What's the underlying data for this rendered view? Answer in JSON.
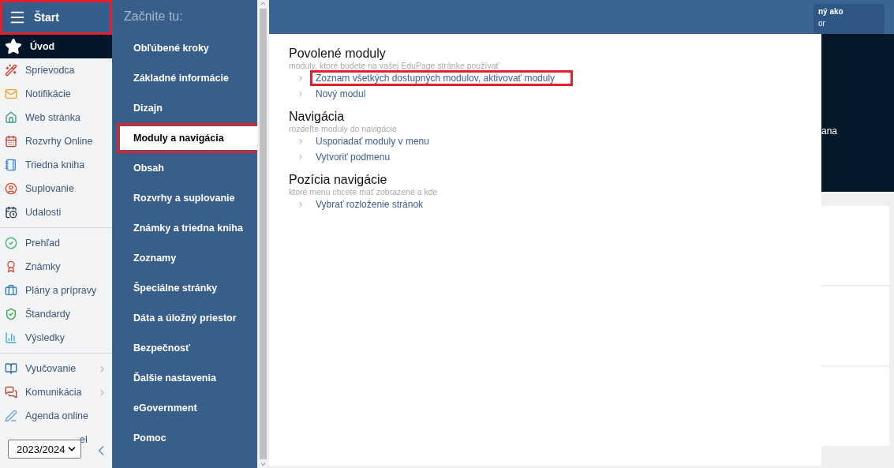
{
  "sidebar": {
    "header": {
      "label": "Štart",
      "highlighted": true
    },
    "groups": [
      {
        "items": [
          {
            "label": "Úvod",
            "selected": true,
            "has_submenu": false
          },
          {
            "label": "Sprievodca",
            "selected": false,
            "has_submenu": false
          },
          {
            "label": "Notifikácie",
            "selected": false,
            "has_submenu": false
          },
          {
            "label": "Web stránka",
            "selected": false,
            "has_submenu": false
          },
          {
            "label": "Rozvrhy Online",
            "selected": false,
            "has_submenu": false
          },
          {
            "label": "Triedna kniha",
            "selected": false,
            "has_submenu": false
          },
          {
            "label": "Suplovanie",
            "selected": false,
            "has_submenu": false
          },
          {
            "label": "Udalosti",
            "selected": false,
            "has_submenu": false
          }
        ]
      },
      {
        "items": [
          {
            "label": "Prehľad",
            "selected": false,
            "has_submenu": false
          },
          {
            "label": "Známky",
            "selected": false,
            "has_submenu": false
          },
          {
            "label": "Plány a prípravy",
            "selected": false,
            "has_submenu": false
          },
          {
            "label": "Štandardy",
            "selected": false,
            "has_submenu": false
          },
          {
            "label": "Výsledky",
            "selected": false,
            "has_submenu": false
          }
        ]
      },
      {
        "items": [
          {
            "label": "Vyučovanie",
            "selected": false,
            "has_submenu": true
          },
          {
            "label": "Komunikácia",
            "selected": false,
            "has_submenu": true
          },
          {
            "label": "Agenda online",
            "selected": false,
            "has_submenu": false
          },
          {
            "label": "el",
            "kind": "covered"
          }
        ]
      }
    ],
    "year_select": {
      "value": "2023/2024"
    }
  },
  "settings_menu": {
    "title": "Začnite tu:",
    "items": [
      {
        "label": "Obľúbené kroky",
        "selected": false
      },
      {
        "label": "Základné informácie",
        "selected": false
      },
      {
        "label": "Dizajn",
        "selected": false
      },
      {
        "label": "Moduly a navigácia",
        "selected": true
      },
      {
        "label": "Obsah",
        "selected": false
      },
      {
        "label": "Rozvrhy a suplovanie",
        "selected": false
      },
      {
        "label": "Známky a triedna kniha",
        "selected": false
      },
      {
        "label": "Zoznamy",
        "selected": false
      },
      {
        "label": "Špeciálne stránky",
        "selected": false
      },
      {
        "label": "Dáta a úložný priestor",
        "selected": false
      },
      {
        "label": "Bezpečnosť",
        "selected": false
      },
      {
        "label": "Ďalšie nastavenia",
        "selected": false
      },
      {
        "label": "eGovernment",
        "selected": false
      },
      {
        "label": "Pomoc",
        "selected": false
      }
    ]
  },
  "content": {
    "sections": [
      {
        "title": "Povolené moduly",
        "subtitle": "moduly, ktoré budete na vašej EduPage stránke používať",
        "links": [
          {
            "label": "Zoznam všetkých dostupných modulov, aktivovať moduly",
            "highlighted": true
          },
          {
            "label": "Nový modul",
            "highlighted": false
          }
        ]
      },
      {
        "title": "Navigácia",
        "subtitle": "rozdeľte moduly do navigácie",
        "links": [
          {
            "label": "Usporiadať moduly v menu",
            "highlighted": false
          },
          {
            "label": "Vytvoriť podmenu",
            "highlighted": false
          }
        ]
      },
      {
        "title": "Pozícia navigácie",
        "subtitle": "ktoré menu chcete mať zobrazené a kde",
        "links": [
          {
            "label": "Vybrať rozloženie stránok",
            "highlighted": false
          }
        ]
      }
    ]
  },
  "background_page": {
    "login_box": {
      "line_1": "ný ako",
      "line_2": "or"
    },
    "banner_text": "ana"
  }
}
